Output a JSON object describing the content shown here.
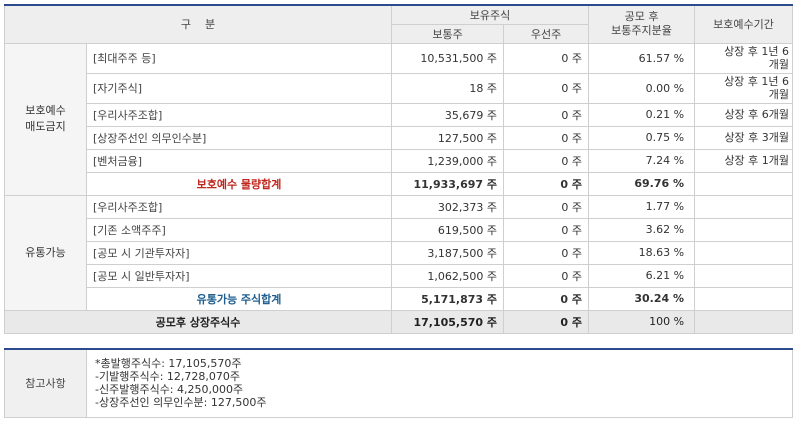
{
  "header": {
    "category": "구    분",
    "holding": "보유주식",
    "common": "보통주",
    "preferred": "우선주",
    "ratio_line1": "공모 후",
    "ratio_line2": "보통주지분율",
    "period": "보호예수기간"
  },
  "protected": {
    "group_line1": "보호예수",
    "group_line2": "매도금지",
    "rows": [
      {
        "label": "[최대주주 등]",
        "common": "10,531,500 주",
        "preferred": "0 주",
        "ratio": "61.57 %",
        "period_line1": "상장 후 1년 6",
        "period_line2": "개월"
      },
      {
        "label": "[자기주식]",
        "common": "18 주",
        "preferred": "0 주",
        "ratio": "0.00 %",
        "period_line1": "상장 후 1년 6",
        "period_line2": "개월"
      },
      {
        "label": "[우리사주조합]",
        "common": "35,679 주",
        "preferred": "0 주",
        "ratio": "0.21 %",
        "period_line1": "상장 후 6개월",
        "period_line2": ""
      },
      {
        "label": "[상장주선인 의무인수분]",
        "common": "127,500 주",
        "preferred": "0 주",
        "ratio": "0.75 %",
        "period_line1": "상장 후 3개월",
        "period_line2": ""
      },
      {
        "label": "[벤처금융]",
        "common": "1,239,000 주",
        "preferred": "0 주",
        "ratio": "7.24 %",
        "period_line1": "상장 후 1개월",
        "period_line2": ""
      }
    ],
    "subtotal": {
      "label": "보호예수 물량합계",
      "common": "11,933,697 주",
      "preferred": "0 주",
      "ratio": "69.76 %"
    }
  },
  "tradable": {
    "group": "유통가능",
    "rows": [
      {
        "label": "[우리사주조합]",
        "common": "302,373 주",
        "preferred": "0 주",
        "ratio": "1.77 %"
      },
      {
        "label": "[기존 소액주주]",
        "common": "619,500 주",
        "preferred": "0 주",
        "ratio": "3.62 %"
      },
      {
        "label": "[공모 시 기관투자자]",
        "common": "3,187,500 주",
        "preferred": "0 주",
        "ratio": "18.63 %"
      },
      {
        "label": "[공모 시 일반투자자]",
        "common": "1,062,500 주",
        "preferred": "0 주",
        "ratio": "6.21 %"
      }
    ],
    "subtotal": {
      "label": "유통가능 주식합계",
      "common": "5,171,873 주",
      "preferred": "0 주",
      "ratio": "30.24 %"
    }
  },
  "total": {
    "label": "공모후 상장주식수",
    "common": "17,105,570 주",
    "preferred": "0 주",
    "ratio": "100 %"
  },
  "note": {
    "label": "참고사항",
    "lines": [
      "*총발행주식수: 17,105,570주",
      "-기발행주식수: 12,728,070주",
      "-신주발행주식수: 4,250,000주",
      "-상장주선인 의무인수분: 127,500주"
    ]
  },
  "colors": {
    "border_accent": "#2b4b8c",
    "subtotal_red": "#c0261d",
    "subtotal_blue": "#1f5e8f"
  }
}
